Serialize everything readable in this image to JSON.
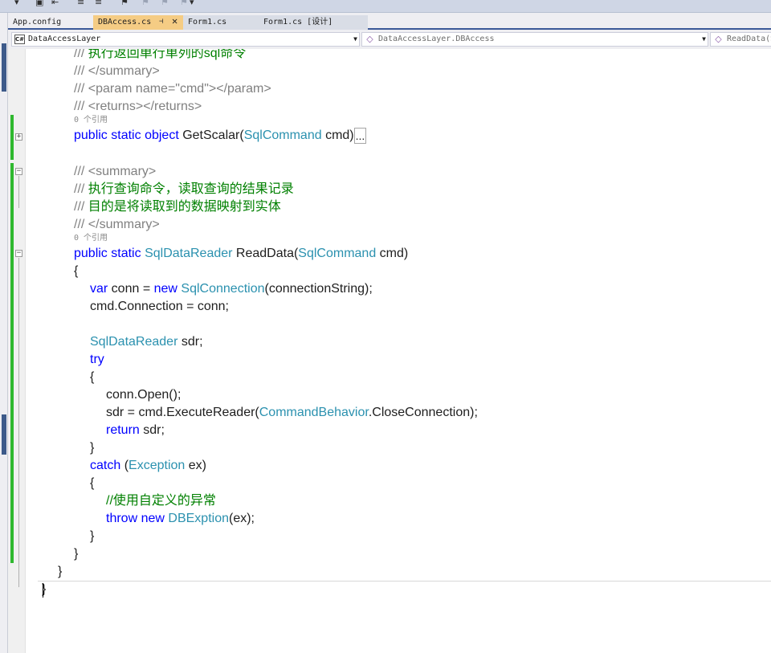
{
  "toolbar": {
    "glyphs": [
      "▾",
      "▣",
      "⇤",
      "≡",
      "≡",
      "⚑",
      "⚑",
      "⚑",
      "⚑",
      "▾"
    ]
  },
  "tabs": [
    {
      "label": "App.config"
    },
    {
      "label": "DBAccess.cs",
      "pin": "⊣",
      "close": "✕"
    },
    {
      "label": "Form1.cs"
    },
    {
      "label": "Form1.cs [设计]"
    }
  ],
  "nav": {
    "project": {
      "icon": "C#",
      "label": "DataAccessLayer"
    },
    "type": {
      "icon": "◇",
      "label": "DataAccessLayer.DBAccess"
    },
    "member": {
      "icon": "◇",
      "label": "ReadData(S"
    }
  },
  "editor": {
    "ref_count": "0 个引用",
    "lines": [
      {
        "parts": [
          {
            "t": "/// ",
            "c": "xd"
          },
          {
            "t": "执行返回单行单列的sql命令",
            "c": "cm"
          }
        ]
      },
      {
        "parts": [
          {
            "t": "/// ",
            "c": "xd"
          },
          {
            "t": "</summary>",
            "c": "xd"
          }
        ]
      },
      {
        "parts": [
          {
            "t": "/// ",
            "c": "xd"
          },
          {
            "t": "<param name=\"cmd\"></param>",
            "c": "xd"
          }
        ]
      },
      {
        "parts": [
          {
            "t": "/// ",
            "c": "xd"
          },
          {
            "t": "<returns></returns>",
            "c": "xd"
          }
        ]
      },
      {
        "parts": [
          {
            "t": "public",
            "c": "kw"
          },
          {
            "t": " "
          },
          {
            "t": "static",
            "c": "kw"
          },
          {
            "t": " "
          },
          {
            "t": "object",
            "c": "kw"
          },
          {
            "t": " GetScalar("
          },
          {
            "t": "SqlCommand",
            "c": "ty"
          },
          {
            "t": " cmd)"
          }
        ],
        "collapsed": "..."
      },
      {
        "parts": []
      },
      {
        "parts": [
          {
            "t": "/// ",
            "c": "xd"
          },
          {
            "t": "<summary>",
            "c": "xd"
          }
        ]
      },
      {
        "parts": [
          {
            "t": "/// ",
            "c": "xd"
          },
          {
            "t": "执行查询命令，读取查询的结果记录",
            "c": "cm"
          }
        ]
      },
      {
        "parts": [
          {
            "t": "/// ",
            "c": "xd"
          },
          {
            "t": "目的是将读取到的数据映射到实体",
            "c": "cm"
          }
        ]
      },
      {
        "parts": [
          {
            "t": "/// ",
            "c": "xd"
          },
          {
            "t": "</summary>",
            "c": "xd"
          }
        ]
      },
      {
        "parts": [
          {
            "t": "public",
            "c": "kw"
          },
          {
            "t": " "
          },
          {
            "t": "static",
            "c": "kw"
          },
          {
            "t": " "
          },
          {
            "t": "SqlDataReader",
            "c": "ty"
          },
          {
            "t": " ReadData("
          },
          {
            "t": "SqlCommand",
            "c": "ty"
          },
          {
            "t": " cmd)"
          }
        ]
      },
      {
        "parts": [
          {
            "t": "{"
          }
        ]
      },
      {
        "parts": [
          {
            "t": "var",
            "c": "kw"
          },
          {
            "t": " conn = "
          },
          {
            "t": "new",
            "c": "kw"
          },
          {
            "t": " "
          },
          {
            "t": "SqlConnection",
            "c": "ty"
          },
          {
            "t": "(connectionString);"
          }
        ]
      },
      {
        "parts": [
          {
            "t": "cmd.Connection = conn;"
          }
        ]
      },
      {
        "parts": []
      },
      {
        "parts": [
          {
            "t": "SqlDataReader",
            "c": "ty"
          },
          {
            "t": " sdr;"
          }
        ]
      },
      {
        "parts": [
          {
            "t": "try",
            "c": "kw"
          }
        ]
      },
      {
        "parts": [
          {
            "t": "{"
          }
        ]
      },
      {
        "parts": [
          {
            "t": "conn.Open();"
          }
        ]
      },
      {
        "parts": [
          {
            "t": "sdr = cmd.ExecuteReader("
          },
          {
            "t": "CommandBehavior",
            "c": "ty"
          },
          {
            "t": ".CloseConnection);"
          }
        ]
      },
      {
        "parts": [
          {
            "t": "return",
            "c": "kw"
          },
          {
            "t": " sdr;"
          }
        ]
      },
      {
        "parts": [
          {
            "t": "}"
          }
        ]
      },
      {
        "parts": [
          {
            "t": "catch",
            "c": "kw"
          },
          {
            "t": " ("
          },
          {
            "t": "Exception",
            "c": "ty"
          },
          {
            "t": " ex)"
          }
        ]
      },
      {
        "parts": [
          {
            "t": "{"
          }
        ]
      },
      {
        "parts": [
          {
            "t": "//使用自定义的异常",
            "c": "cm"
          }
        ]
      },
      {
        "parts": [
          {
            "t": "throw",
            "c": "kw"
          },
          {
            "t": " "
          },
          {
            "t": "new",
            "c": "kw"
          },
          {
            "t": " "
          },
          {
            "t": "DBExption",
            "c": "ty"
          },
          {
            "t": "(ex);"
          }
        ]
      },
      {
        "parts": [
          {
            "t": "}"
          }
        ]
      },
      {
        "parts": [
          {
            "t": "}"
          }
        ]
      },
      {
        "parts": [
          {
            "t": "}"
          }
        ]
      },
      {
        "parts": [
          {
            "t": "}"
          }
        ]
      }
    ]
  },
  "colors": {
    "keyword": "#0000ff",
    "type": "#2b91af",
    "comment": "#008000",
    "xmldoc": "#808080",
    "change_bar": "#2fb82f",
    "active_tab": "#f5cc84"
  }
}
